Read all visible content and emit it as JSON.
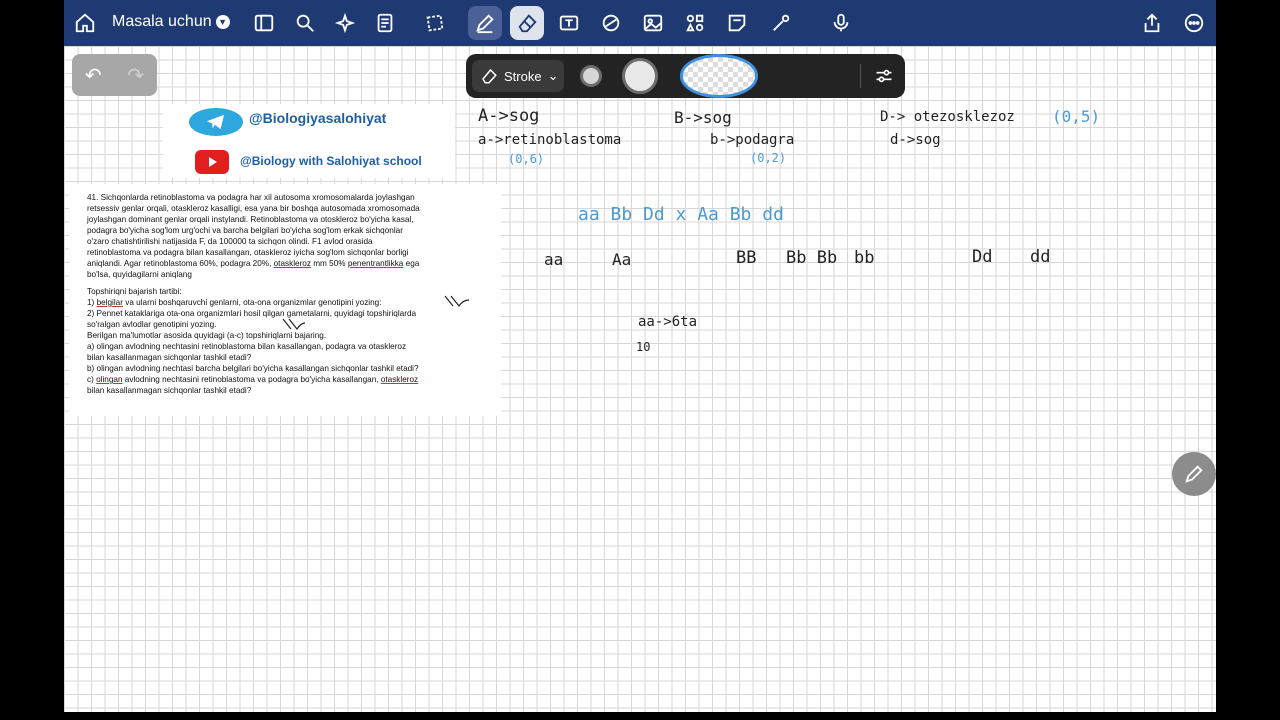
{
  "topbar": {
    "title": "Masala uchun",
    "icons": [
      "home-icon",
      "sidebar-icon",
      "search-icon",
      "sparkle-icon",
      "document-icon",
      "lasso-icon",
      "pen-icon",
      "eraser-icon",
      "textbox-icon",
      "shapes-icon",
      "image-icon",
      "elements-icon",
      "sticky-note-icon",
      "laser-icon",
      "mic-icon",
      "share-icon",
      "more-icon"
    ]
  },
  "undo": "↶",
  "redo": "↷",
  "stroke_toolbar": {
    "label": "Stroke",
    "swatch_color": "#3e8fe0"
  },
  "banner": {
    "telegram": "@Biologiyasalohiyat",
    "youtube": "@Biology with Salohiyat school"
  },
  "problem": {
    "p1": "41. Sichqonlarda retinoblastoma va podagra har xil autosoma xromosomalarda joylashgan",
    "p2": "retsessiv genlar orqali, otaskleroz kasalligi, esa yana bir boshqa autosomada xromosomada",
    "p3": "joylashgan dominant genlar orqali instylandi. Retinoblastoma va otoskleroz bo'yicha kasal,",
    "p4": "podagra bo'yicha sog'lom urg'ochi va barcha belgilari bo'yicha sog'lom erkak sichqonlar",
    "p5": "o'zaro chatishtirilishi natijasida F, da 100000 ta sichqon olindi. F1 avlod orasida",
    "p6": "retinoblastoma va podagra bilan kasallangan, otaskleroz iyicha sog'lom sichqonlar borligi",
    "p7": "aniqlandi. Agar retinoblastoma 60%, podagra 20%,",
    "p7_u": "otaskleroz",
    "p7b": "mm 50%",
    "p7_u2": "penentrantlikka",
    "p7c": "ega",
    "p8": "bo'lsa, quyidagilarni aniqlang",
    "t0": "Topshiriqni bajarish tartibi:",
    "t1a": "1)",
    "t1u": "belgilar",
    "t1b": "va ularni boshqaruvchi genlarni, ota-ona organizmlar genotipini yozing:",
    "t2": "2) Pennet kataklariga ota-ona organizmlari hosil qilgan gametalarni, quyidagi topshiriqlarda",
    "t3": "so'ralgan avlodlar genotipini yozing.",
    "t4": "Berilgan ma'lumotlar asosida quyidagi (a-c) topshiriqlarni bajaring.",
    "t5": "a) olingan avlodning nechtasini retinoblastoma bilan kasallangan, podagra va otaskleroz",
    "t6": "bilan kasallanmagan sichqonlar tashkil etadi?",
    "t7": "b) olingan avlodning nechtasi barcha belgilari bo'yicha kasallangan sichqonlar tashkil etadi?",
    "t8a": "c)",
    "t8u": "olingan",
    "t8b": "avlodning nechtasini retinoblastoma va podagra bo'yicha kasallangan,",
    "t8u2": "otaskleroz",
    "t9": "bilan kasallanmagan sichqonlar tashkil etadi?"
  },
  "handwriting": {
    "a1": "A->sog",
    "a2": "a->retinoblastoma",
    "a3": "(0,6)",
    "b1": "B->sog",
    "b2": "b->podagra",
    "b3": "(0,2)",
    "d1": "D-> otezosklezoz",
    "d1n": "(0,5)",
    "d2": "d->sog",
    "cross": "aa Bb Dd  x  Aa Bb dd",
    "g1": "aa",
    "g2": "Aa",
    "g3": "BB",
    "g4": "Bb Bb",
    "g5": "bb",
    "g6": "Dd",
    "g7": "dd",
    "n1": "aa->6ta",
    "n2": "10"
  }
}
